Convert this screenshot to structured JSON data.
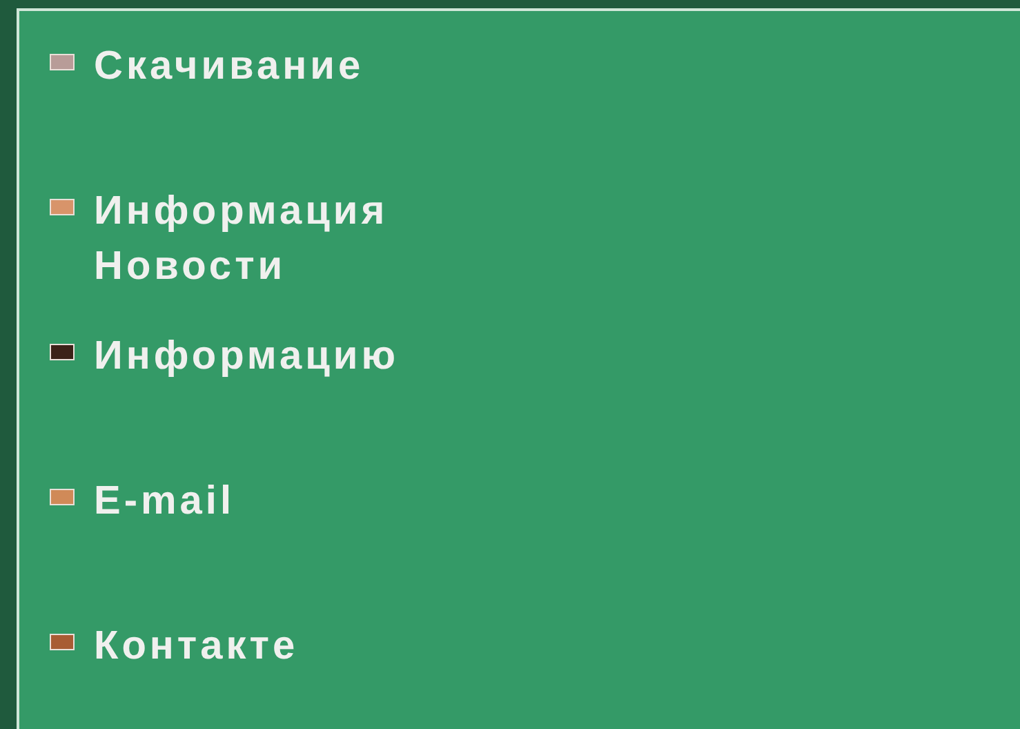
{
  "menu": [
    {
      "lines": [
        "Скачивание"
      ],
      "color": "#b89c98"
    },
    {
      "lines": [
        "Информация",
        "Новости"
      ],
      "color": "#d8946a"
    },
    {
      "lines": [
        "Информацию"
      ],
      "color": "#3c2218"
    },
    {
      "lines": [
        "E-mail"
      ],
      "color": "#d08a58"
    },
    {
      "lines": [
        "Контакте"
      ],
      "color": "#a85c34"
    }
  ]
}
